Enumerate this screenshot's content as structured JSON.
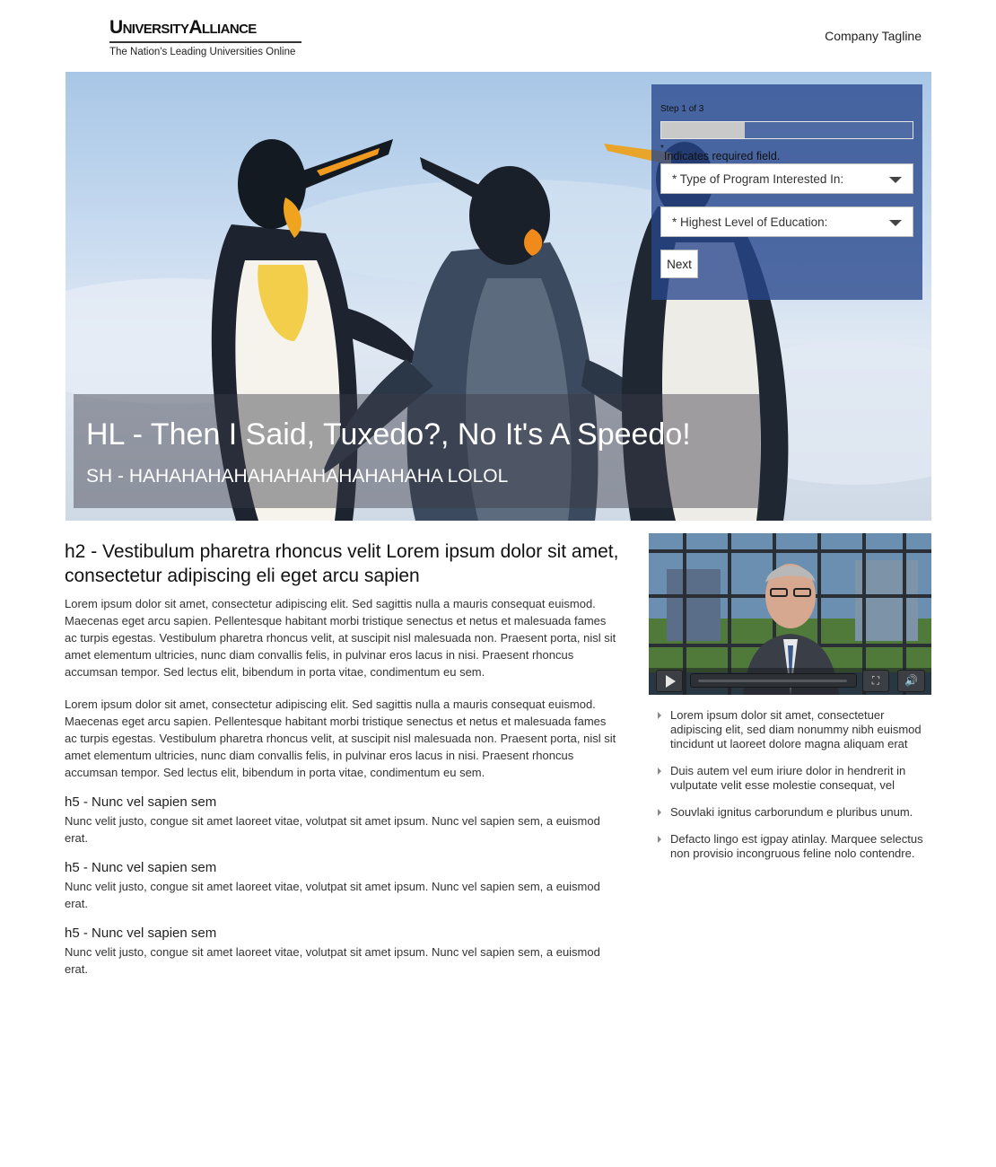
{
  "header": {
    "logo_wordmark": "UniversityAlliance",
    "logo_subtitle": "The Nation's Leading Universities Online",
    "tagline": "Company Tagline"
  },
  "hero": {
    "headline": "HL - Then I Said, Tuxedo?, No It's A Speedo!",
    "subheadline": "SH - HAHAHAHAHAHAHAHAHAHAHAHA LOLOL",
    "image_subject": "three penguins against a sky"
  },
  "lead_form": {
    "step_text": "Step 1 of 3",
    "progress_fraction": 0.333,
    "required_star": "*",
    "required_note": "Indicates required field.",
    "program_select": "* Type of Program Interested In:",
    "education_select": "* Highest Level of Education:",
    "next_label": "Next",
    "panel_color": "#284690"
  },
  "main": {
    "h2": "h2 - Vestibulum pharetra rhoncus velit Lorem ipsum dolor sit amet, consectetur adipiscing eli eget arcu sapien",
    "paragraphs": [
      "Lorem ipsum dolor sit amet, consectetur adipiscing elit. Sed sagittis nulla a mauris consequat euismod. Maecenas eget arcu sapien. Pellentesque habitant morbi tristique senectus et netus et malesuada fames ac turpis egestas. Vestibulum pharetra rhoncus velit, at suscipit nisl malesuada non. Praesent porta, nisl sit amet elementum ultricies, nunc diam convallis felis, in pulvinar eros lacus in nisi. Praesent rhoncus accumsan tempor. Sed lectus elit, bibendum in porta vitae, condimentum eu sem.",
      "Lorem ipsum dolor sit amet, consectetur adipiscing elit. Sed sagittis nulla a mauris consequat euismod. Maecenas eget arcu sapien. Pellentesque habitant morbi tristique senectus et netus et malesuada fames ac turpis egestas. Vestibulum pharetra rhoncus velit, at suscipit nisl malesuada non. Praesent porta, nisl sit amet elementum ultricies, nunc diam convallis felis, in pulvinar eros lacus in nisi. Praesent rhoncus accumsan tempor. Sed lectus elit, bibendum in porta vitae, condimentum eu sem."
    ],
    "sections": [
      {
        "heading": "h5 - Nunc vel sapien sem",
        "text": "Nunc velit justo, congue sit amet laoreet vitae, volutpat sit amet ipsum. Nunc vel sapien sem, a euismod erat."
      },
      {
        "heading": "h5 - Nunc vel sapien sem",
        "text": "Nunc velit justo, congue sit amet laoreet vitae, volutpat sit amet ipsum. Nunc vel sapien sem, a euismod erat."
      },
      {
        "heading": "h5 - Nunc vel sapien sem",
        "text": "Nunc velit justo, congue sit amet laoreet vitae, volutpat sit amet ipsum. Nunc vel sapien sem, a euismod erat."
      }
    ]
  },
  "sidebar": {
    "video": {
      "play_icon": "play-icon",
      "fullscreen_icon": "fullscreen-icon",
      "volume_icon": "volume-icon"
    },
    "bullets": [
      "Lorem ipsum dolor sit amet, consectetuer adipiscing elit, sed diam nonummy nibh euismod tincidunt ut laoreet dolore magna aliquam erat",
      "Duis autem vel eum iriure dolor in hendrerit in vulputate velit esse molestie consequat, vel",
      "Souvlaki ignitus carborundum e pluribus unum.",
      "Defacto lingo est igpay atinlay. Marquee selectus non provisio incongruous feline nolo contendre."
    ]
  }
}
